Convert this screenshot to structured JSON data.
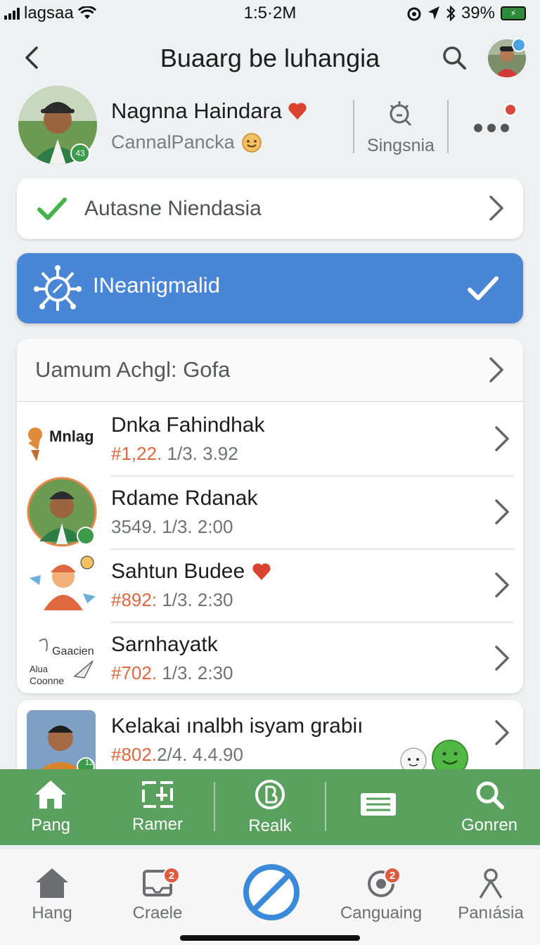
{
  "status_bar": {
    "carrier": "lagsaa",
    "time": "1:5·2M",
    "battery": "39%"
  },
  "header": {
    "title": "Buaarg be luhangia"
  },
  "profile": {
    "name": "Nagnna Haindara",
    "subtitle": "CannalPancka",
    "action_label": "Singsnia",
    "avatar_badge": "43"
  },
  "verify_row": {
    "label": "Autasne Niendasia"
  },
  "highlight_row": {
    "label": "INeanigmalid"
  },
  "list": {
    "header": "Uamum Achgl: Gofa",
    "items": [
      {
        "name": "Dnka Fahindhak",
        "tag": "#1,22.",
        "meta": "1/3. 3.92",
        "thumb_text": "Mnlag"
      },
      {
        "name": "Rdame Rdanak",
        "tag": "",
        "meta": "3549. 1/3. 2:00",
        "thumb_text": ""
      },
      {
        "name": "Sahtun Budee",
        "tag": "#892:",
        "meta": "1/3. 2:30",
        "thumb_text": ""
      },
      {
        "name": "Sarnhayatk",
        "tag": "#702.",
        "meta": "1/3. 2:30",
        "thumb_text": "Gaacien",
        "thumb_text2": "Alua",
        "thumb_text3": "Coonne"
      }
    ]
  },
  "last_item": {
    "name": "Kelakai ınalbh isyam grabiı",
    "tag": "#802.",
    "meta": "2/4. 4.4.90",
    "thumb_badge": "13"
  },
  "green_tabs": [
    {
      "label": "Pang",
      "icon": "home-icon"
    },
    {
      "label": "Ramer",
      "icon": "frame-icon"
    },
    {
      "label": "Realk",
      "icon": "circle-b-icon"
    },
    {
      "label": "",
      "icon": "list-icon"
    },
    {
      "label": "Gonren",
      "icon": "search-icon"
    }
  ],
  "bottom_tabs": [
    {
      "label": "Hang",
      "icon": "home-icon",
      "badge": ""
    },
    {
      "label": "Craele",
      "icon": "inbox-icon",
      "badge": "2"
    },
    {
      "label": "",
      "icon": "blocked-icon",
      "badge": ""
    },
    {
      "label": "Canguaing",
      "icon": "camera-icon",
      "badge": "2"
    },
    {
      "label": "Panıásia",
      "icon": "person-icon",
      "badge": ""
    }
  ],
  "colors": {
    "accent_blue": "#4a86d6",
    "green_bar": "#5aa05e",
    "tag_orange": "#e0683e",
    "check_green": "#46b24a",
    "badge_red": "#e05a3f"
  }
}
